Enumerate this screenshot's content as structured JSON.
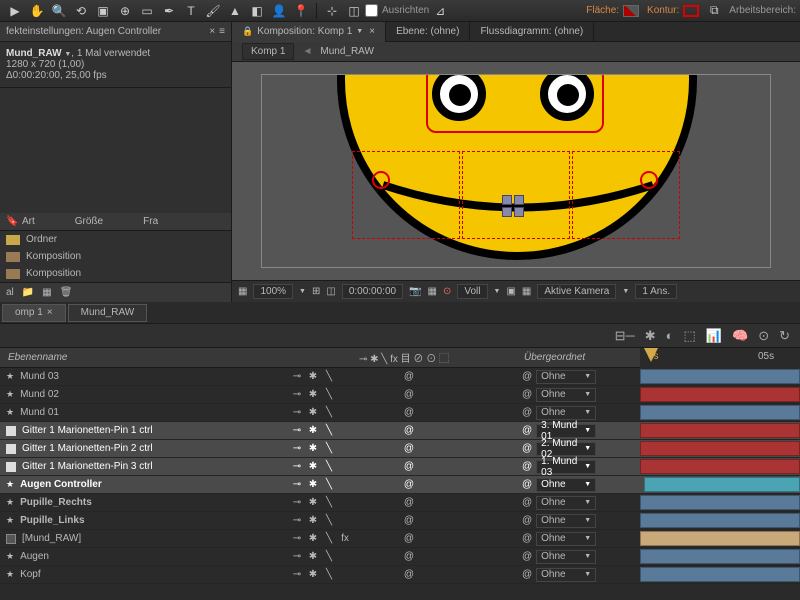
{
  "toolbar": {
    "ausrichten": "Ausrichten",
    "flaeche": "Fläche:",
    "kontur": "Kontur:",
    "arbeitsbereich": "Arbeitsbereich:"
  },
  "effectPanel": {
    "title": "fekteinstellungen: Augen Controller",
    "layerName": "Mund_RAW",
    "usage": ", 1 Mal verwendet",
    "dims": "1280 x 720 (1,00)",
    "duration": "Δ0:00:20:00, 25,00 fps"
  },
  "project": {
    "cols": {
      "art": "Art",
      "groesse": "Größe",
      "fra": "Fra"
    },
    "items": [
      {
        "type": "folder",
        "label": "Ordner"
      },
      {
        "type": "comp",
        "label": "Komposition"
      },
      {
        "type": "comp",
        "label": "Komposition"
      }
    ],
    "footer": "al"
  },
  "compTabs": {
    "komposition": "Komposition: Komp 1",
    "ebene": "Ebene: (ohne)",
    "flussdiagramm": "Flussdiagramm: (ohne)"
  },
  "breadcrumb": {
    "komp": "Komp 1",
    "mund": "Mund_RAW"
  },
  "viewer": {
    "zoom": "100%",
    "time": "0:00:00:00",
    "voll": "Voll",
    "kamera": "Aktive Kamera",
    "ans": "1 Ans."
  },
  "timelineTabs": {
    "komp": "omp 1",
    "mund": "Mund_RAW"
  },
  "timelineHeader": {
    "ebenenname": "Ebenenname",
    "uebergeordnet": "Übergeordnet"
  },
  "layers": [
    {
      "icon": "star",
      "name": "Mund 03",
      "parent": "Ohne",
      "parentIcon": "@",
      "fx": "",
      "bar": "blue"
    },
    {
      "icon": "star",
      "name": "Mund 02",
      "parent": "Ohne",
      "parentIcon": "@",
      "fx": "",
      "bar": "red"
    },
    {
      "icon": "star",
      "name": "Mund 01",
      "parent": "Ohne",
      "parentIcon": "@",
      "fx": "",
      "bar": "blue"
    },
    {
      "icon": "white",
      "name": "Gitter 1 Marionetten-Pin 1 ctrl",
      "parent": "3. Mund 01",
      "parentIcon": "@",
      "fx": "",
      "sel": true,
      "bar": "red"
    },
    {
      "icon": "white",
      "name": "Gitter 1 Marionetten-Pin 2 ctrl",
      "parent": "2. Mund 02",
      "parentIcon": "@",
      "fx": "",
      "sel": true,
      "bar": "red"
    },
    {
      "icon": "white",
      "name": "Gitter 1 Marionetten-Pin 3 ctrl",
      "parent": "1. Mund 03",
      "parentIcon": "@",
      "fx": "",
      "sel": true,
      "bar": "red"
    },
    {
      "icon": "star",
      "name": "Augen Controller",
      "parent": "Ohne",
      "parentIcon": "@",
      "fx": "",
      "sel": true,
      "bold": true,
      "bar": "cyan"
    },
    {
      "icon": "star",
      "name": "Pupille_Rechts",
      "parent": "Ohne",
      "parentIcon": "@",
      "fx": "",
      "bold": true,
      "bar": "blue"
    },
    {
      "icon": "star",
      "name": "Pupille_Links",
      "parent": "Ohne",
      "parentIcon": "@",
      "fx": "",
      "bold": true,
      "bar": "blue"
    },
    {
      "icon": "comp",
      "name": "[Mund_RAW]",
      "parent": "Ohne",
      "parentIcon": "@",
      "fx": "fx",
      "bar": "peach"
    },
    {
      "icon": "star",
      "name": "Augen",
      "parent": "Ohne",
      "parentIcon": "@",
      "fx": "",
      "bar": "blue"
    },
    {
      "icon": "star",
      "name": "Kopf",
      "parent": "Ohne",
      "parentIcon": "@",
      "fx": "",
      "bar": "blue"
    }
  ],
  "ruler": {
    "t0": "0s",
    "t5": "05s"
  }
}
